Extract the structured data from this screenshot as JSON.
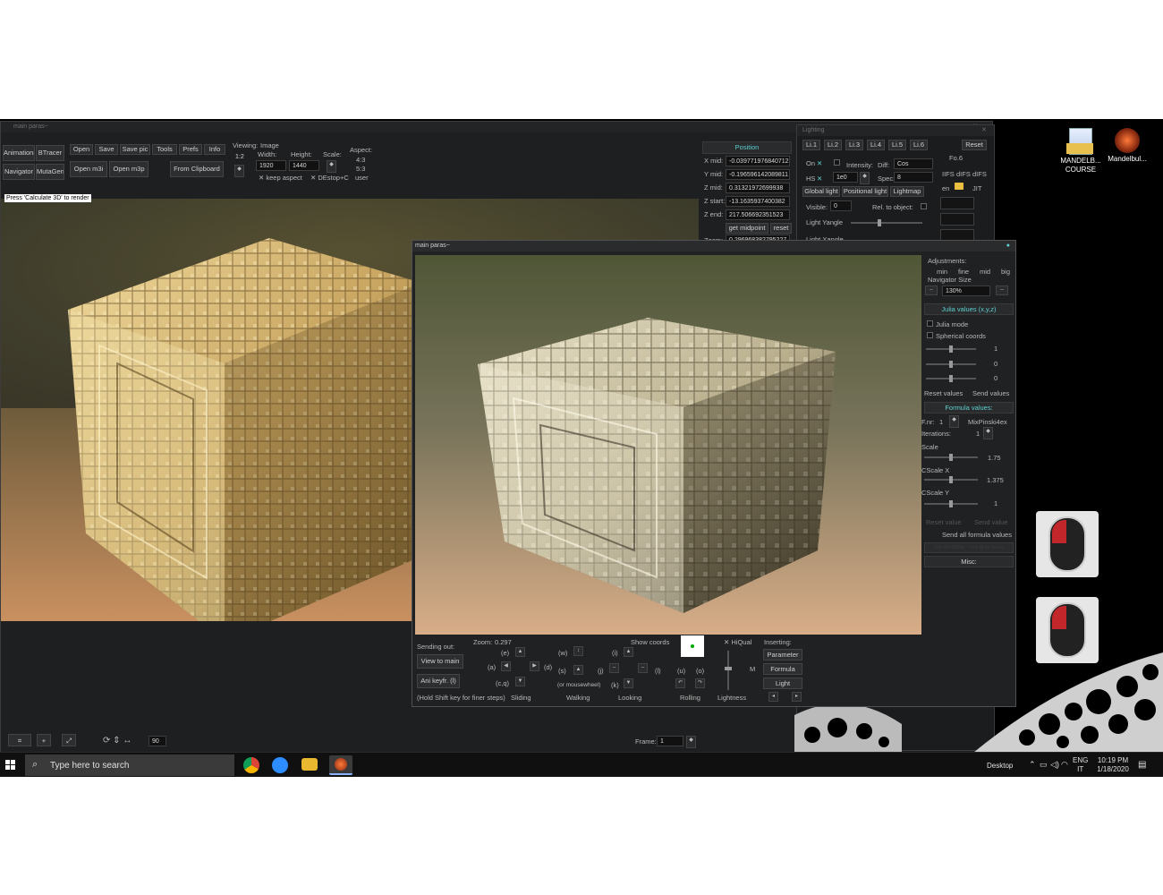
{
  "main_window": {
    "title": "main paras~",
    "buttons": {
      "animations": "Animations",
      "btracer": "BTracer",
      "navigator": "Navigator",
      "mutagen": "MutaGen",
      "open": "Open",
      "save": "Save",
      "save_pic": "Save pic",
      "tools": "Tools",
      "prefs": "Prefs",
      "info": "Info",
      "open_m3i": "Open m3i",
      "open_m3p": "Open m3p",
      "from_clipboard": "From Clipboard",
      "get_midpoint": "get midpoint",
      "reset": "reset"
    },
    "viewing_label": "Viewing:",
    "viewing_value": "1:2",
    "image_label": "Image",
    "width_label": "Width:",
    "width_value": "1920",
    "height_label": "Height:",
    "height_value": "1440",
    "scale_label": "Scale:",
    "aspect_label": "Aspect:",
    "aspect_values": [
      "4:3",
      "5:3",
      "user"
    ],
    "keep_aspect": "keep aspect",
    "destop": "DEstop+C",
    "status_hint": "Press 'Calculate 3D' to render",
    "position_header": "Position",
    "position": [
      {
        "label": "X mid:",
        "value": "-0.0397719768407123"
      },
      {
        "label": "Y mid:",
        "value": "-0.196596142089811"
      },
      {
        "label": "Z mid:",
        "value": "0.31321972699938"
      },
      {
        "label": "Z start:",
        "value": "-13.1635937400382"
      },
      {
        "label": "Z end:",
        "value": "217.506692351523"
      },
      {
        "label": "Zoom:",
        "value": "0.296968382795227"
      }
    ],
    "bottom_value": "90",
    "frame_label": "Frame:",
    "frame_value": "1"
  },
  "lighting": {
    "title": "Lighting",
    "tabs": [
      "Li.1",
      "Li.2",
      "Li.3",
      "Li.4",
      "Li.5",
      "Li.6"
    ],
    "reset": "Reset",
    "fo_label": "Fo.6",
    "on_label": "On",
    "hs_label": "HS",
    "intensity_label": "Intensity:",
    "diff_label": "Diff:",
    "diff_value": "Cos",
    "spec_label": "Spec:",
    "spec_value": "8",
    "hs_value": "1e0",
    "difs": [
      "IIFS",
      "dIFS",
      "dIFS"
    ],
    "en_label": "en",
    "jit_label": "JIT",
    "tabs2": [
      "Global light",
      "Positional light",
      "Lightmap"
    ],
    "visible_label": "Visible:",
    "visible_value": "0",
    "rel_label": "Rel. to object:",
    "yangle_label": "Light Yangle",
    "xangle_label": "Light Xangle"
  },
  "navigator": {
    "title": "main paras~",
    "adjustments_label": "Adjustments:",
    "adj_options": [
      "min",
      "fine",
      "mid",
      "big"
    ],
    "nav_size_label": "Navigator Size",
    "nav_size_value": "130%",
    "julia_header": "Julia values (x,y,z)",
    "julia_mode": "Julia mode",
    "spherical": "Spherical coords",
    "julia_values": [
      "1",
      "0",
      "0"
    ],
    "reset_values": "Reset values",
    "send_values": "Send values",
    "formula_header": "Formula values:",
    "fnr_label": "F.nr:",
    "fnr_value": "1",
    "formula_name": "MixPinski4ex",
    "iterations_label": "Iterations:",
    "iterations_value": "1",
    "params": [
      {
        "label": "Scale",
        "value": "1.75"
      },
      {
        "label": "CScale X",
        "value": "1.375"
      },
      {
        "label": "CScale Y",
        "value": "1"
      }
    ],
    "reset_value": "Reset value",
    "send_value": "Send value",
    "send_all": "Send all formula values",
    "faded_row": "Not dividable - see gray value",
    "misc": "Misc:",
    "sending_out": "Sending out:",
    "view_to_main": "View to main",
    "ani_keyfr": "Ani keyfr. (l)",
    "hold_shift": "(Hold Shift key for finer steps)",
    "zoom_label": "Zoom:",
    "zoom_value": "0.297",
    "show_coords": "Show coords",
    "hiqual": "HiQual",
    "inserting": "Inserting:",
    "parameter": "Parameter",
    "formula": "Formula",
    "light": "Light",
    "keys": {
      "e": "(e)",
      "a": "(a)",
      "d": "(d)",
      "cq": "(c,q)",
      "w": "(w)",
      "s": "(s)",
      "wheel": "(or mousewheel)",
      "i": "(i)",
      "j": "(j)",
      "l": "(l)",
      "k": "(k)",
      "u": "(u)",
      "o": "(o)",
      "m": "M"
    },
    "groups": [
      "Sliding",
      "Walking",
      "Looking",
      "Rolling",
      "Lightness"
    ]
  },
  "desktop": {
    "icons": [
      "MANDELB... COURSE",
      "Mandelbul..."
    ]
  },
  "taskbar": {
    "search_placeholder": "Type here to search",
    "desktop_label": "Desktop",
    "lang": "ENG",
    "lang2": "IT",
    "time": "10:19 PM",
    "date": "1/18/2020"
  }
}
